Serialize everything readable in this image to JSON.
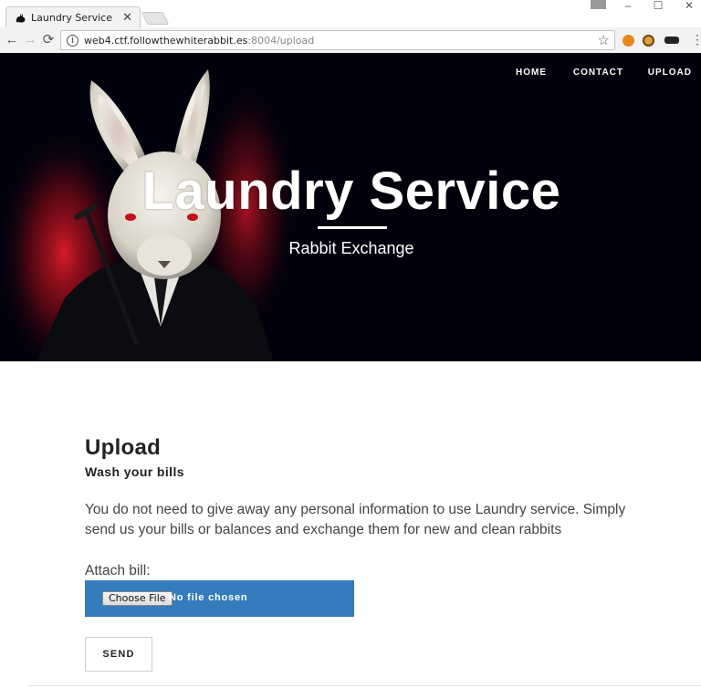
{
  "browser": {
    "tab_title": "Laundry Service",
    "tab_close": "✕",
    "url_host": "web4.ctf.followthewhiterabbit.es",
    "url_rest": ":8004/upload",
    "back_icon": "←",
    "forward_icon": "→",
    "reload_icon": "⟳",
    "info_icon": "i",
    "star_icon": "☆",
    "menu_icon": "⋮",
    "minimize_icon": "–",
    "maximize_icon": "☐",
    "close_icon": "✕"
  },
  "nav": {
    "items": [
      {
        "label": "HOME"
      },
      {
        "label": "CONTACT"
      },
      {
        "label": "UPLOAD"
      }
    ]
  },
  "hero": {
    "title": "Laundry Service",
    "subtitle": "Rabbit Exchange"
  },
  "upload": {
    "title": "Upload",
    "subtitle": "Wash your bills",
    "body": "You do not need to give away any personal information to use Laundry service. Simply send us your bills or balances and exchange them for new and clean rabbits",
    "attach_label": "Attach bill:",
    "choose_file_label": "Choose File",
    "no_file_text": "No file chosen",
    "send_label": "SEND"
  },
  "colors": {
    "hero_bg": "#01010d",
    "file_box": "#347cbc",
    "accent_red": "#d01a28"
  }
}
